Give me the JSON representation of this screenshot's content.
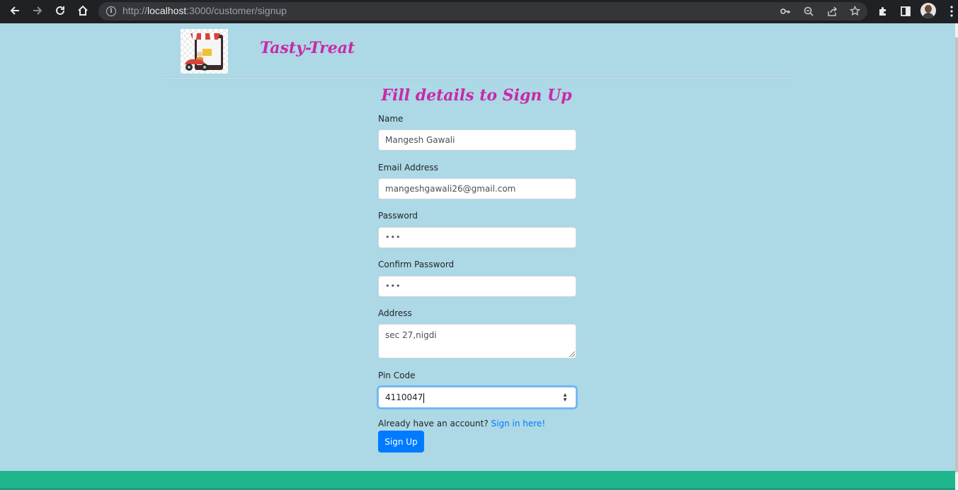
{
  "browser": {
    "url_scheme": "http://",
    "url_host": "localhost",
    "url_path": ":3000/customer/signup",
    "icons": {
      "back": "back-arrow-icon",
      "forward": "forward-arrow-icon",
      "reload": "reload-icon",
      "home": "home-icon",
      "site_info": "info-icon",
      "password": "key-icon",
      "zoom": "zoom-icon",
      "share": "share-icon",
      "bookmark": "star-icon",
      "extensions": "puzzle-icon",
      "side_panel": "side-panel-icon",
      "profile": "avatar",
      "menu": "kebab-menu-icon"
    }
  },
  "header": {
    "brand": "Tasty-Treat"
  },
  "form": {
    "title": "Fill details to Sign Up",
    "name_label": "Name",
    "name_value": "Mangesh Gawali",
    "email_label": "Email Address",
    "email_value": "mangeshgawali26@gmail.com",
    "password_label": "Password",
    "password_value": "•••",
    "confirm_label": "Confirm Password",
    "confirm_value": "•••",
    "address_label": "Address",
    "address_value": "sec 27,nigdi",
    "pin_label": "Pin Code",
    "pin_value": "4110047",
    "signin_prompt": "Already have an account?",
    "signin_link": "Sign in here!",
    "submit_label": "Sign Up"
  },
  "colors": {
    "page_background": "#add8e6",
    "brand": "#c82aa8",
    "button": "#007bff",
    "footer": "#1fb68c"
  }
}
